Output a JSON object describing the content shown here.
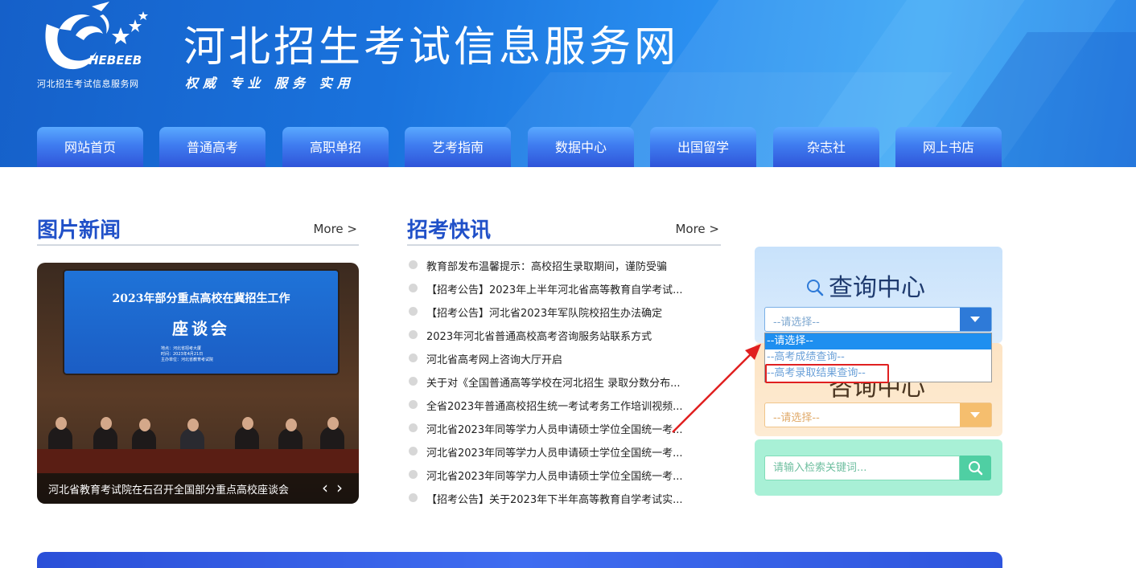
{
  "header": {
    "logo_text": "HEBEEB",
    "logo_subtitle": "河北招生考试信息服务网",
    "site_title": "河北招生考试信息服务网",
    "slogan": "权威 专业 服务 实用"
  },
  "nav": {
    "items": [
      {
        "label": "网站首页"
      },
      {
        "label": "普通高考"
      },
      {
        "label": "高职单招"
      },
      {
        "label": "艺考指南"
      },
      {
        "label": "数据中心"
      },
      {
        "label": "出国留学"
      },
      {
        "label": "杂志社"
      },
      {
        "label": "网上书店"
      }
    ]
  },
  "picture_news": {
    "title": "图片新闻",
    "more": "More >",
    "screen_title": "2023年部分重点高校在冀招生工作",
    "screen_subtitle": "座谈会",
    "screen_small_lines": [
      "地点：河北省招考大厦",
      "时间：2023年4月21日",
      "主办单位：河北省教育考试院"
    ],
    "caption": "河北省教育考试院在石召开全国部分重点高校座谈会",
    "prev": "‹",
    "next": "›"
  },
  "quick_news": {
    "title": "招考快讯",
    "more": "More >",
    "items": [
      {
        "text": "教育部发布温馨提示：高校招生录取期间，谨防受骗"
      },
      {
        "text": "【招考公告】2023年上半年河北省高等教育自学考试..."
      },
      {
        "text": "【招考公告】河北省2023年军队院校招生办法确定"
      },
      {
        "text": "2023年河北省普通高校高考咨询服务站联系方式"
      },
      {
        "text": "河北省高考网上咨询大厅开启"
      },
      {
        "text": "关于对《全国普通高等学校在河北招生 录取分数分布..."
      },
      {
        "text": "全省2023年普通高校招生统一考试考务工作培训视频..."
      },
      {
        "text": "河北省2023年同等学力人员申请硕士学位全国统一考..."
      },
      {
        "text": "河北省2023年同等学力人员申请硕士学位全国统一考..."
      },
      {
        "text": "河北省2023年同等学力人员申请硕士学位全国统一考..."
      },
      {
        "text": "【招考公告】关于2023年下半年高等教育自学考试实..."
      }
    ]
  },
  "query_center": {
    "title": "查询中心",
    "select_value": "--请选择--",
    "options": [
      {
        "label": "--请选择--"
      },
      {
        "label": "--高考成绩查询--"
      },
      {
        "label": "--高考录取结果查询--"
      }
    ]
  },
  "score_center": {
    "title": "咨询中心",
    "select_value": "--请选择--"
  },
  "search": {
    "placeholder": "请输入检索关键词..."
  },
  "colors": {
    "nav_bg": "#3f7cf0",
    "title_blue": "#2050c8",
    "query_btn": "#2e7ad8",
    "score_btn": "#f5be6e",
    "search_btn": "#4fcfa3",
    "annotation_red": "#e02020"
  }
}
